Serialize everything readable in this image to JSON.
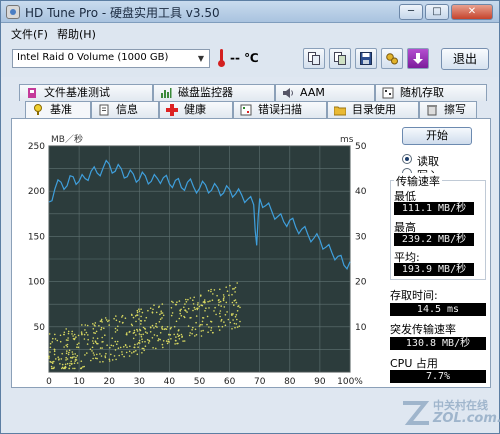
{
  "window": {
    "title": "HD Tune Pro - 硬盘实用工具 v3.50",
    "controls": [
      "─",
      "□",
      "✕"
    ]
  },
  "menu": {
    "file": "文件(F)",
    "help": "帮助(H)"
  },
  "toolbar": {
    "drive": "Intel   Raid 0 Volume (1000 GB)",
    "temperature": "-- ℃",
    "exit_label": "退出"
  },
  "tabs_top": [
    {
      "label": "文件基准测试",
      "icon": "file-benchmark-icon"
    },
    {
      "label": "磁盘监控器",
      "icon": "disk-monitor-icon"
    },
    {
      "label": "AAM",
      "icon": "speaker-icon"
    },
    {
      "label": "随机存取",
      "icon": "random-access-icon"
    }
  ],
  "tabs_bottom": [
    {
      "label": "基准",
      "icon": "benchmark-icon",
      "active": true
    },
    {
      "label": "信息",
      "icon": "info-icon"
    },
    {
      "label": "健康",
      "icon": "health-icon"
    },
    {
      "label": "错误扫描",
      "icon": "error-scan-icon"
    },
    {
      "label": "目录使用",
      "icon": "folder-icon"
    },
    {
      "label": "擦写",
      "icon": "erase-icon"
    }
  ],
  "side": {
    "start_label": "开始",
    "read_label": "读取",
    "write_label": "写入",
    "transfer_rate_title": "传输速率",
    "min_label": "最低",
    "min_value": "111.1 MB/秒",
    "max_label": "最高",
    "max_value": "239.2 MB/秒",
    "avg_label": "平均:",
    "avg_value": "193.9 MB/秒",
    "access_label": "存取时间:",
    "access_value": "14.5 ms",
    "burst_label": "突发传输速率",
    "burst_value": "130.8 MB/秒",
    "cpu_label": "CPU 占用",
    "cpu_value": "7.7%"
  },
  "watermark": {
    "cn": "中关村在线",
    "url": "ZOL.com.cn"
  },
  "colors": {
    "chart_bg": "#2c3c3c",
    "grid": "#5f7272",
    "line": "#3f9fdc",
    "dots": "#d8d860"
  },
  "chart_data": {
    "type": "line",
    "ylabel_left": "MB／秒",
    "ylabel_right": "ms",
    "x_ticks": [
      "0",
      "10",
      "20",
      "30",
      "40",
      "50",
      "60",
      "70",
      "80",
      "90",
      "100%"
    ],
    "y_left_ticks": [
      "250",
      "200",
      "150",
      "100",
      "50"
    ],
    "y_right_ticks": [
      "50",
      "40",
      "30",
      "20",
      "10"
    ],
    "ylim_left": [
      0,
      250
    ],
    "ylim_right": [
      0,
      50
    ],
    "xlim": [
      0,
      100
    ],
    "series": [
      {
        "x": [
          0,
          2,
          4,
          6,
          8,
          10,
          12,
          14,
          16,
          18,
          20,
          22,
          24,
          26,
          28,
          30,
          32,
          34,
          36,
          38,
          40,
          42,
          44,
          46,
          48,
          50,
          52,
          54,
          56,
          58,
          60,
          62,
          64,
          66,
          68,
          69,
          70,
          72,
          74,
          76,
          78,
          80,
          82,
          84,
          86,
          88,
          90,
          92,
          94,
          96,
          98,
          100
        ],
        "values": [
          188,
          203,
          210,
          206,
          216,
          211,
          214,
          222,
          220,
          226,
          230,
          222,
          225,
          216,
          219,
          213,
          217,
          211,
          214,
          215,
          208,
          212,
          204,
          210,
          205,
          203,
          207,
          201,
          204,
          198,
          202,
          197,
          196,
          191,
          185,
          140,
          192,
          184,
          178,
          172,
          166,
          168,
          160,
          158,
          152,
          148,
          146,
          138,
          132,
          128,
          118,
          122
        ]
      }
    ],
    "scatter_note": "access time points 0–64%",
    "grid": true
  }
}
